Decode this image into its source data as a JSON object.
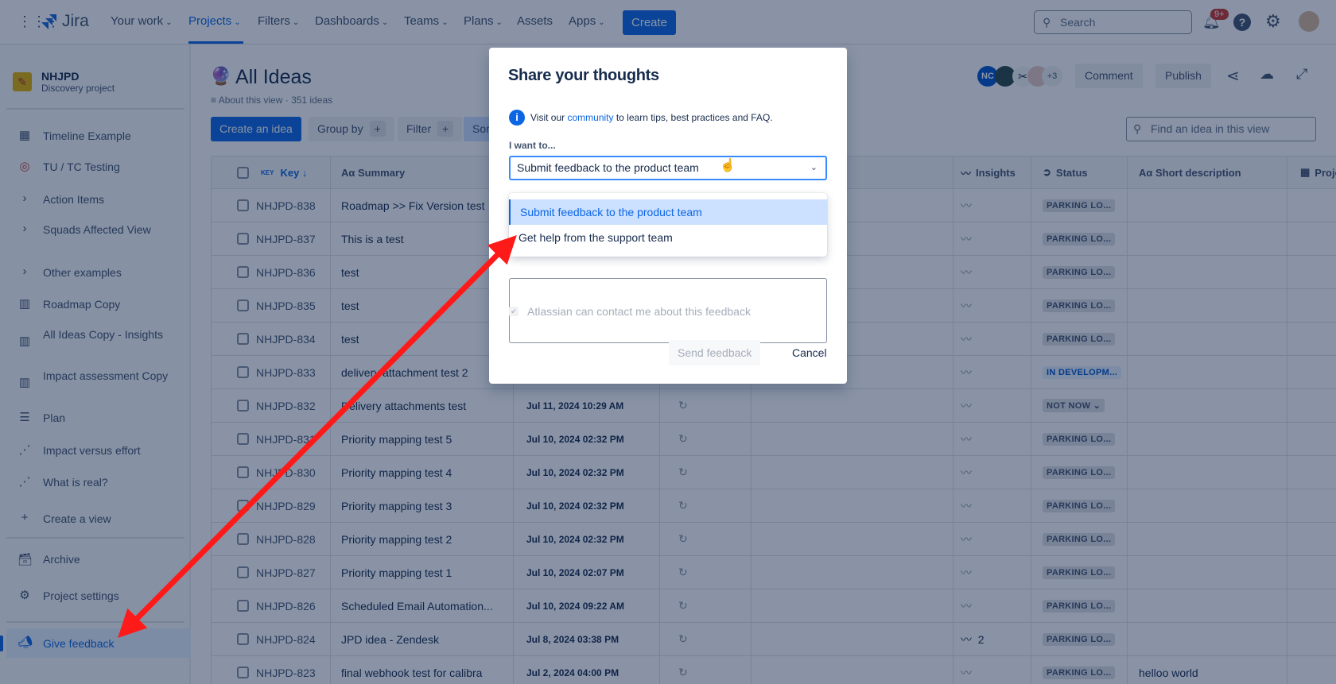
{
  "nav": {
    "logo": "Jira",
    "items": [
      {
        "label": "Your work",
        "chev": true
      },
      {
        "label": "Projects",
        "chev": true,
        "active": true
      },
      {
        "label": "Filters",
        "chev": true
      },
      {
        "label": "Dashboards",
        "chev": true
      },
      {
        "label": "Teams",
        "chev": true
      },
      {
        "label": "Plans",
        "chev": true
      },
      {
        "label": "Assets",
        "chev": false
      },
      {
        "label": "Apps",
        "chev": true
      }
    ],
    "create": "Create",
    "search_placeholder": "Search",
    "notif_badge": "9+"
  },
  "sidebar": {
    "project_name": "NHJPD",
    "project_type": "Discovery project",
    "items": [
      {
        "label": "Timeline Example",
        "icon": "calendar-icon"
      },
      {
        "label": "TU / TC Testing",
        "icon": "target-icon"
      },
      {
        "label": "Action Items",
        "icon": "chevron-right-icon"
      },
      {
        "label": "Squads Affected View",
        "icon": "chevron-right-icon"
      },
      {
        "label": "Other examples",
        "icon": "chevron-right-icon"
      },
      {
        "label": "Roadmap Copy",
        "icon": "board-icon"
      },
      {
        "label": "All Ideas Copy - Insights",
        "icon": "board-icon"
      },
      {
        "label": "Impact assessment Copy",
        "icon": "board-icon"
      },
      {
        "label": "Plan",
        "icon": "list-icon"
      },
      {
        "label": "Impact versus effort",
        "icon": "matrix-icon"
      },
      {
        "label": "What is real?",
        "icon": "matrix-icon"
      },
      {
        "label": "Create a view",
        "icon": "plus-icon"
      }
    ],
    "archive": "Archive",
    "settings": "Project settings",
    "feedback": "Give feedback"
  },
  "main": {
    "title": "All Ideas",
    "about": "About this view",
    "count": "351 ideas",
    "create_idea": "Create an idea",
    "group_by": "Group by",
    "filter": "Filter",
    "sort": "Sort",
    "avatars_more": "+3",
    "avatar_initials": "NC",
    "comment": "Comment",
    "publish": "Publish",
    "find_placeholder": "Find an idea in this view"
  },
  "table": {
    "headers": {
      "key_tag": "KEY",
      "key": "Key ↓",
      "summary": "Aα Summary",
      "insights": "Insights",
      "status": "Status",
      "short_desc": "Aα Short description",
      "project": "Proje"
    },
    "rows": [
      {
        "key": "NHJPD-838",
        "summary": "Roadmap >> Fix Version test",
        "date": "",
        "insights": "",
        "status": "PARKING LO..."
      },
      {
        "key": "NHJPD-837",
        "summary": "This is a test",
        "date": "",
        "insights": "",
        "status": "PARKING LO..."
      },
      {
        "key": "NHJPD-836",
        "summary": "test",
        "date": "",
        "insights": "",
        "status": "PARKING LO..."
      },
      {
        "key": "NHJPD-835",
        "summary": "test",
        "date": "",
        "insights": "",
        "status": "PARKING LO..."
      },
      {
        "key": "NHJPD-834",
        "summary": "test",
        "date": "",
        "insights": "",
        "status": "PARKING LO..."
      },
      {
        "key": "NHJPD-833",
        "summary": "delivery attachment test 2",
        "date": "",
        "insights": "",
        "status": "IN DEVELOPM...",
        "status_color": "blue"
      },
      {
        "key": "NHJPD-832",
        "summary": "Delivery attachments test",
        "date": "Jul 11, 2024 10:29 AM",
        "insights": "",
        "status": "NOT NOW ⌄"
      },
      {
        "key": "NHJPD-831",
        "summary": "Priority mapping test 5",
        "date": "Jul 10, 2024 02:32 PM",
        "insights": "",
        "status": "PARKING LO..."
      },
      {
        "key": "NHJPD-830",
        "summary": "Priority mapping test 4",
        "date": "Jul 10, 2024 02:32 PM",
        "insights": "",
        "status": "PARKING LO..."
      },
      {
        "key": "NHJPD-829",
        "summary": "Priority mapping test 3",
        "date": "Jul 10, 2024 02:32 PM",
        "insights": "",
        "status": "PARKING LO..."
      },
      {
        "key": "NHJPD-828",
        "summary": "Priority mapping test 2",
        "date": "Jul 10, 2024 02:32 PM",
        "insights": "",
        "status": "PARKING LO..."
      },
      {
        "key": "NHJPD-827",
        "summary": "Priority mapping test 1",
        "date": "Jul 10, 2024 02:07 PM",
        "insights": "",
        "status": "PARKING LO..."
      },
      {
        "key": "NHJPD-826",
        "summary": "Scheduled Email Automation...",
        "date": "Jul 10, 2024 09:22 AM",
        "insights": "",
        "status": "PARKING LO..."
      },
      {
        "key": "NHJPD-824",
        "summary": "JPD idea - Zendesk",
        "date": "Jul 8, 2024 03:38 PM",
        "insights": "2",
        "status": "PARKING LO..."
      },
      {
        "key": "NHJPD-823",
        "summary": "final webhook test for calibra",
        "date": "Jul 2, 2024 04:00 PM",
        "insights": "",
        "status": "PARKING LO...",
        "short_desc": "helloo world"
      }
    ]
  },
  "dialog": {
    "title": "Share your thoughts",
    "info_prefix": "Visit our",
    "info_link": "community",
    "info_suffix": "to learn tips, best practices and FAQ.",
    "want_label": "I want to...",
    "selected": "Submit feedback to the product team",
    "options": [
      "Submit feedback to the product team",
      "Get help from the support team"
    ],
    "contact_label": "Atlassian can contact me about this feedback",
    "send": "Send feedback",
    "cancel": "Cancel"
  },
  "colors": {
    "brand": "#0c66e4",
    "annotation_arrow": "#ff1a1a"
  }
}
